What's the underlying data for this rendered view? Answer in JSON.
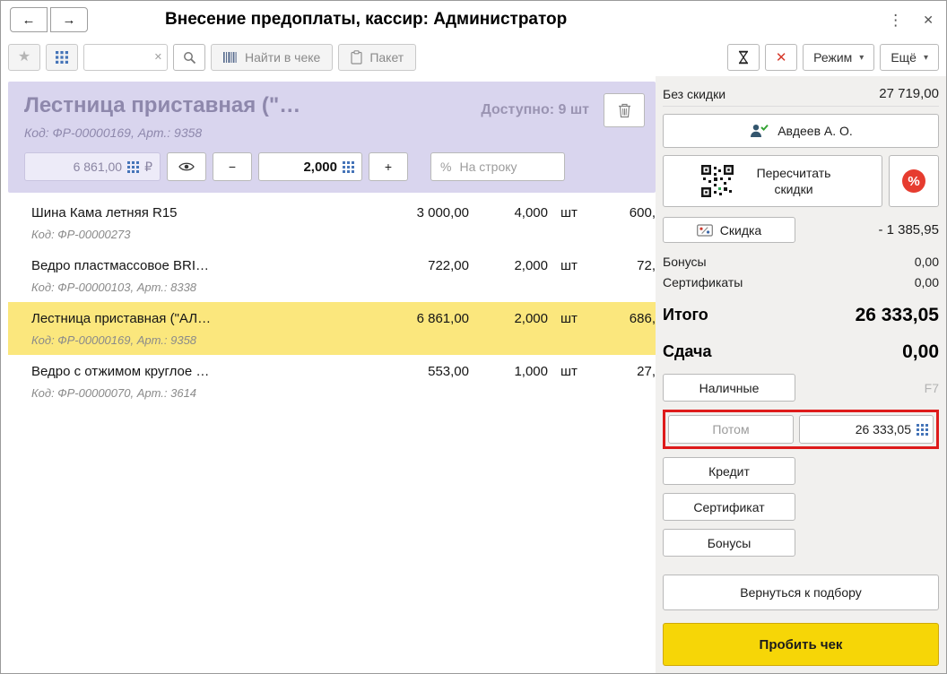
{
  "titlebar": {
    "title": "Внесение предоплаты, кассир: Администратор"
  },
  "icons": {
    "back": "←",
    "forward": "→",
    "kebab": "⋮",
    "close": "✕",
    "star": "★",
    "clear": "✕",
    "red_x": "✕",
    "chevron_down": "▾",
    "percent": "%"
  },
  "toolbar": {
    "search_value": "",
    "find_in_check_label": "Найти в чеке",
    "packet_label": "Пакет",
    "mode_label": "Режим",
    "more_label": "Ещё"
  },
  "product_card": {
    "title": "Лестница приставная (\"…",
    "code": "Код: ФР-00000169, Арт.: 9358",
    "available": "Доступно: 9 шт",
    "price": "6 861,00",
    "currency": "₽",
    "minus": "−",
    "plus": "+",
    "quantity": "2,000",
    "percent_sign": "%",
    "per_line_placeholder": "На строку"
  },
  "rows": [
    {
      "name": "Шина Кама летняя R15",
      "price": "3 000,00",
      "qty": "4,000",
      "unit": "шт",
      "amount": "600,",
      "code": "Код: ФР-00000273"
    },
    {
      "name": "Ведро пластмассовое BRI…",
      "price": "722,00",
      "qty": "2,000",
      "unit": "шт",
      "amount": "72,",
      "code": "Код: ФР-00000103, Арт.: 8338"
    },
    {
      "name": "Лестница приставная (\"АЛ…",
      "price": "6 861,00",
      "qty": "2,000",
      "unit": "шт",
      "amount": "686,",
      "code": "Код: ФР-00000169, Арт.: 9358"
    },
    {
      "name": "Ведро с отжимом  круглое …",
      "price": "553,00",
      "qty": "1,000",
      "unit": "шт",
      "amount": "27,",
      "code": "Код: ФР-00000070, Арт.: 3614"
    }
  ],
  "summary": {
    "no_discount_label": "Без скидки",
    "no_discount_value": "27 719,00",
    "customer": "Авдеев А. О.",
    "recalc_label": "Пересчитать скидки",
    "discount_label": "Скидка",
    "discount_value": "- 1 385,95",
    "bonuses_label": "Бонусы",
    "bonuses_value": "0,00",
    "certificates_label": "Сертификаты",
    "certificates_value": "0,00",
    "total_label": "Итого",
    "total_value": "26 333,05",
    "change_label": "Сдача",
    "change_value": "0,00"
  },
  "payments": {
    "cash_label": "Наличные",
    "cash_hotkey": "F7",
    "later_label": "Потом",
    "later_value": "26 333,05",
    "credit_label": "Кредит",
    "certificate_label": "Сертификат",
    "bonuses_label": "Бонусы",
    "back_label": "Вернуться к подбору",
    "commit_label": "Пробить чек"
  },
  "colors": {
    "selection_yellow": "#fbe77d",
    "card_lavender": "#d9d5ee",
    "highlight_red": "#de1b1b",
    "commit_yellow": "#f6d607",
    "keypad_blue": "#4574b8"
  }
}
